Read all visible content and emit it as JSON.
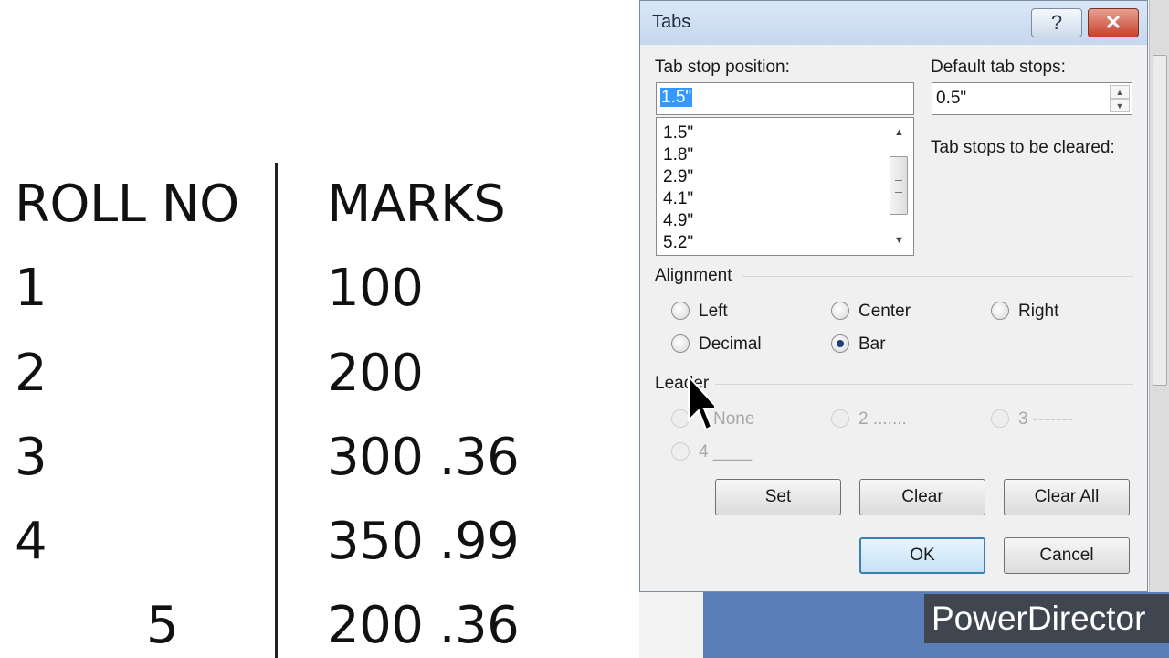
{
  "document": {
    "header_roll": "ROLL NO",
    "header_marks": "MARKS",
    "rows": [
      {
        "roll": "1",
        "marks": "100"
      },
      {
        "roll": "2",
        "marks": "200"
      },
      {
        "roll": "3",
        "marks": "300 .36"
      },
      {
        "roll": "4",
        "marks": "350 .99"
      },
      {
        "roll": "5",
        "marks": "200 .36"
      }
    ]
  },
  "dialog": {
    "title": "Tabs",
    "help_label": "?",
    "close_label": "✕",
    "tab_stop_label": "Tab stop position:",
    "tab_stop_value": "1.5\"",
    "tab_stop_list": [
      "1.5\"",
      "1.8\"",
      "2.9\"",
      "4.1\"",
      "4.9\"",
      "5.2\""
    ],
    "default_tab_label": "Default tab stops:",
    "default_tab_value": "0.5\"",
    "cleared_label": "Tab stops to be cleared:",
    "alignment": {
      "label": "Alignment",
      "options": [
        "Left",
        "Center",
        "Right",
        "Decimal",
        "Bar"
      ],
      "selected": "Bar"
    },
    "leader": {
      "label": "Leader",
      "options": [
        "None",
        "2 .......",
        "3 -------",
        "4 ____"
      ]
    },
    "buttons": {
      "set": "Set",
      "clear": "Clear",
      "clear_all": "Clear All",
      "ok": "OK",
      "cancel": "Cancel"
    }
  },
  "watermark": "PowerDirector",
  "icons": {
    "cursor": "arrow-cursor-icon",
    "spin_up": "▲",
    "spin_down": "▼",
    "scroll_up": "▲",
    "scroll_down": "▼"
  }
}
